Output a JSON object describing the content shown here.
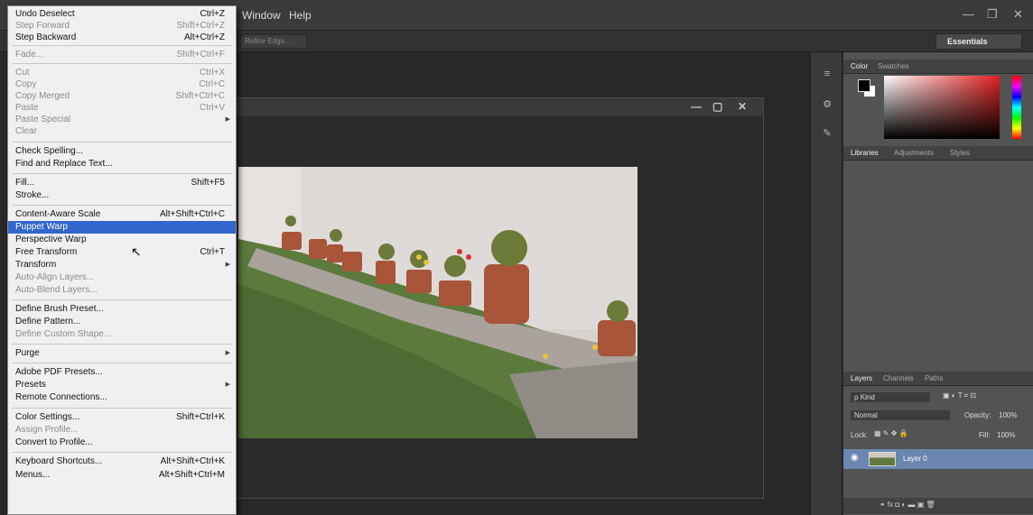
{
  "menubar": {
    "items": [
      "Window",
      "Help"
    ],
    "window_controls": [
      "—",
      "❐",
      "✕"
    ]
  },
  "options_bar": {
    "refine_edge": "Refine Edge...",
    "workspace": "Essentials"
  },
  "document": {
    "controls": [
      "—",
      "▢",
      "✕"
    ]
  },
  "panels": {
    "color_tabs": [
      "Color",
      "Swatches"
    ],
    "library_tabs": [
      "Libraries",
      "Adjustments",
      "Styles"
    ],
    "layers_tabs": [
      "Layers",
      "Channels",
      "Paths"
    ],
    "kind": "ρ Kind",
    "blend_mode": "Normal",
    "opacity_label": "Opacity:",
    "opacity_value": "100%",
    "lock_label": "Lock:",
    "fill_label": "Fill:",
    "fill_value": "100%",
    "layer_name": "Layer 0"
  },
  "edit_menu": {
    "items": [
      {
        "label": "Undo Deselect",
        "shortcut": "Ctrl+Z",
        "disabled": false
      },
      {
        "label": "Step Forward",
        "shortcut": "Shift+Ctrl+Z",
        "disabled": true
      },
      {
        "label": "Step Backward",
        "shortcut": "Alt+Ctrl+Z",
        "disabled": false
      },
      {
        "label": "Fade...",
        "shortcut": "Shift+Ctrl+F",
        "disabled": true
      },
      {
        "label": "Cut",
        "shortcut": "Ctrl+X",
        "disabled": true
      },
      {
        "label": "Copy",
        "shortcut": "Ctrl+C",
        "disabled": true
      },
      {
        "label": "Copy Merged",
        "shortcut": "Shift+Ctrl+C",
        "disabled": true
      },
      {
        "label": "Paste",
        "shortcut": "Ctrl+V",
        "disabled": true
      },
      {
        "label": "Paste Special",
        "shortcut": "",
        "disabled": true
      },
      {
        "label": "Clear",
        "shortcut": "",
        "disabled": true
      },
      {
        "label": "Check Spelling...",
        "shortcut": "",
        "disabled": false
      },
      {
        "label": "Find and Replace Text...",
        "shortcut": "",
        "disabled": false
      },
      {
        "label": "Fill...",
        "shortcut": "Shift+F5",
        "disabled": false
      },
      {
        "label": "Stroke...",
        "shortcut": "",
        "disabled": false
      },
      {
        "label": "Content-Aware Scale",
        "shortcut": "Alt+Shift+Ctrl+C",
        "disabled": false
      },
      {
        "label": "Puppet Warp",
        "shortcut": "",
        "disabled": false
      },
      {
        "label": "Perspective Warp",
        "shortcut": "",
        "disabled": false
      },
      {
        "label": "Free Transform",
        "shortcut": "Ctrl+T",
        "disabled": false
      },
      {
        "label": "Transform",
        "shortcut": "",
        "disabled": false
      },
      {
        "label": "Auto-Align Layers...",
        "shortcut": "",
        "disabled": true
      },
      {
        "label": "Auto-Blend Layers...",
        "shortcut": "",
        "disabled": true
      },
      {
        "label": "Define Brush Preset...",
        "shortcut": "",
        "disabled": false
      },
      {
        "label": "Define Pattern...",
        "shortcut": "",
        "disabled": false
      },
      {
        "label": "Define Custom Shape...",
        "shortcut": "",
        "disabled": true
      },
      {
        "label": "Purge",
        "shortcut": "",
        "disabled": false
      },
      {
        "label": "Adobe PDF Presets...",
        "shortcut": "",
        "disabled": false
      },
      {
        "label": "Presets",
        "shortcut": "",
        "disabled": false
      },
      {
        "label": "Remote Connections...",
        "shortcut": "",
        "disabled": false
      },
      {
        "label": "Color Settings...",
        "shortcut": "Shift+Ctrl+K",
        "disabled": false
      },
      {
        "label": "Assign Profile...",
        "shortcut": "",
        "disabled": true
      },
      {
        "label": "Convert to Profile...",
        "shortcut": "",
        "disabled": false
      },
      {
        "label": "Keyboard Shortcuts...",
        "shortcut": "Alt+Shift+Ctrl+K",
        "disabled": false
      },
      {
        "label": "Menus...",
        "shortcut": "Alt+Shift+Ctrl+M",
        "disabled": false
      }
    ]
  },
  "colors": {
    "menu_highlight": "#3366cc",
    "layer_selected": "#6b87b0"
  }
}
